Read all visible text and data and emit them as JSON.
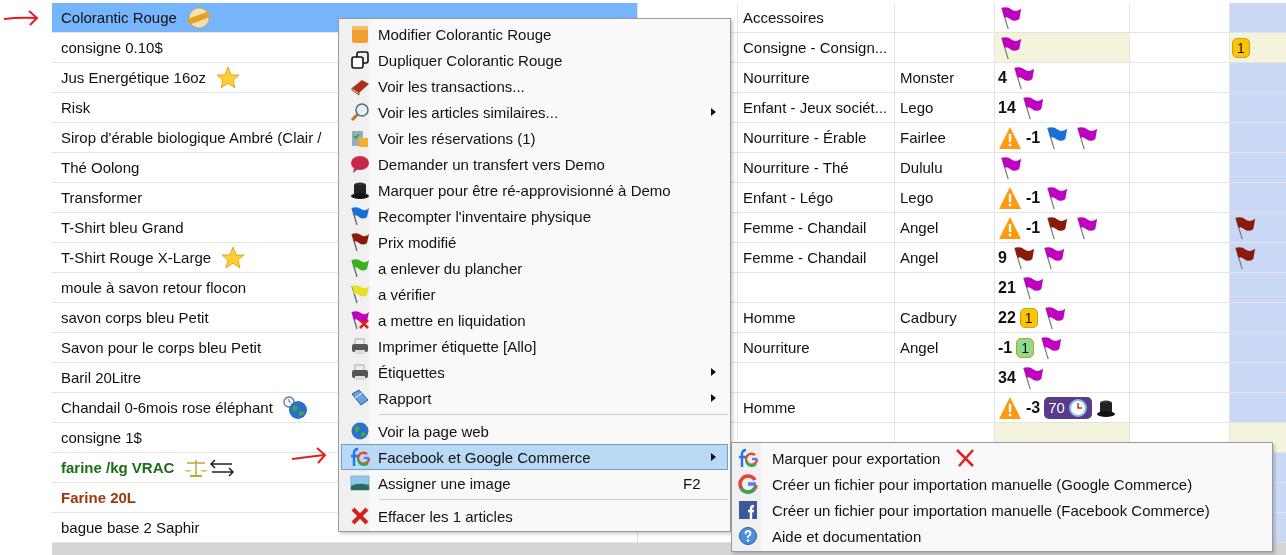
{
  "rows": [
    {
      "name": "Colorantic Rouge",
      "kind": "special",
      "selected": true,
      "qty": "",
      "category": "Accessoires",
      "brand": "",
      "highlight": false,
      "status": [
        {
          "kind": "flag",
          "color": "#c000c0"
        }
      ],
      "extra": []
    },
    {
      "name": "consigne 0.10$",
      "selected": false,
      "category": "Consigne - Consign...",
      "brand": "",
      "highlight": true,
      "status": [
        {
          "kind": "flag",
          "color": "#c000c0"
        }
      ],
      "extra": [
        {
          "kind": "badge",
          "text": "1",
          "color": "#ffc400"
        }
      ]
    },
    {
      "name": "Jus Energétique 16oz",
      "kind": "starred",
      "selected": false,
      "category": "Nourriture",
      "brand": "Monster",
      "highlight": false,
      "status": [
        {
          "kind": "number",
          "text": "4"
        },
        {
          "kind": "flag",
          "color": "#c000c0"
        }
      ],
      "extra": []
    },
    {
      "name": "Risk",
      "selected": false,
      "category": "Enfant - Jeux sociét...",
      "brand": "Lego",
      "highlight": false,
      "status": [
        {
          "kind": "number",
          "text": "14"
        },
        {
          "kind": "flag",
          "color": "#c000c0"
        }
      ],
      "extra": []
    },
    {
      "name": "Sirop d'érable biologique Ambré (Clair /",
      "selected": false,
      "category": "Nourriture - Érable",
      "brand": "Fairlee",
      "highlight": false,
      "status": [
        {
          "kind": "warning"
        },
        {
          "kind": "number",
          "text": "-1"
        },
        {
          "kind": "flag",
          "color": "#1a6fd6"
        },
        {
          "kind": "flag",
          "color": "#c000c0"
        }
      ],
      "extra": []
    },
    {
      "name": "Thé Oolong",
      "selected": false,
      "category": "Nourriture - Thé",
      "brand": "Dululu",
      "highlight": false,
      "status": [
        {
          "kind": "flag",
          "color": "#c000c0"
        }
      ],
      "extra": []
    },
    {
      "name": "Transformer",
      "selected": false,
      "category": "Enfant - Légo",
      "brand": "Lego",
      "highlight": false,
      "status": [
        {
          "kind": "warning"
        },
        {
          "kind": "number",
          "text": "-1"
        },
        {
          "kind": "flag",
          "color": "#c000c0"
        }
      ],
      "extra": []
    },
    {
      "name": "T-Shirt bleu Grand",
      "selected": false,
      "category": "Femme - Chandail",
      "brand": "Angel",
      "highlight": false,
      "status": [
        {
          "kind": "warning"
        },
        {
          "kind": "number",
          "text": "-1"
        },
        {
          "kind": "flag",
          "color": "#8b1a0a"
        },
        {
          "kind": "flag",
          "color": "#c000c0"
        }
      ],
      "extra": [
        {
          "kind": "flag",
          "color": "#8b1a0a"
        }
      ]
    },
    {
      "name": "T-Shirt Rouge X-Large",
      "kind": "starred",
      "selected": false,
      "category": "Femme - Chandail",
      "brand": "Angel",
      "highlight": false,
      "status": [
        {
          "kind": "number",
          "text": "9"
        },
        {
          "kind": "flag",
          "color": "#8b1a0a"
        },
        {
          "kind": "flag",
          "color": "#c000c0"
        }
      ],
      "extra": [
        {
          "kind": "flag",
          "color": "#8b1a0a"
        }
      ]
    },
    {
      "name": "moule à savon retour flocon",
      "selected": false,
      "category": "",
      "brand": "",
      "highlight": false,
      "status": [
        {
          "kind": "number",
          "text": "21"
        },
        {
          "kind": "flag",
          "color": "#c000c0"
        }
      ],
      "extra": []
    },
    {
      "name": "savon corps bleu Petit",
      "selected": false,
      "category": "Homme",
      "brand": "Cadbury",
      "highlight": false,
      "status": [
        {
          "kind": "number",
          "text": "22"
        },
        {
          "kind": "badge",
          "text": "1",
          "color": "#ffc400"
        },
        {
          "kind": "flag",
          "color": "#c000c0"
        }
      ],
      "extra": []
    },
    {
      "name": "Savon pour le corps bleu Petit",
      "selected": false,
      "category": "Nourriture",
      "brand": "Angel",
      "highlight": false,
      "status": [
        {
          "kind": "number",
          "text": "-1"
        },
        {
          "kind": "badge",
          "text": "1",
          "color": "#8fdc8f"
        },
        {
          "kind": "flag",
          "color": "#c000c0"
        }
      ],
      "extra": []
    },
    {
      "name": "Baril 20Litre",
      "selected": false,
      "category": "",
      "brand": "",
      "highlight": false,
      "status": [
        {
          "kind": "number",
          "text": "34"
        },
        {
          "kind": "flag",
          "color": "#c000c0"
        }
      ],
      "extra": []
    },
    {
      "name": "Chandail 0-6mois rose éléphant",
      "kind": "web",
      "selected": false,
      "category": "Homme",
      "brand": "",
      "highlight": false,
      "status": [
        {
          "kind": "warning"
        },
        {
          "kind": "number",
          "text": "-3"
        },
        {
          "kind": "timer",
          "text": "70"
        },
        {
          "kind": "hat"
        }
      ],
      "extra": []
    },
    {
      "name": "consigne 1$",
      "selected": false,
      "category": "",
      "brand": "",
      "highlight": true,
      "status": [],
      "extra": []
    },
    {
      "name": "farine /kg VRAC",
      "kind": "bulk",
      "selected": false,
      "bold": true,
      "color": "#1a6e14",
      "category": "",
      "brand": "",
      "status": [],
      "extra": []
    },
    {
      "name": "Farine 20L",
      "selected": false,
      "bold": true,
      "color": "#9a3a0a",
      "category": "",
      "brand": "",
      "status": [],
      "extra": []
    },
    {
      "name": "bague base 2 Saphir",
      "selected": false,
      "category": "",
      "brand": "",
      "status": [],
      "extra": []
    }
  ],
  "context_menu": [
    {
      "kind": "item",
      "label": "Modifier Colorantic Rouge",
      "submenu": false,
      "selected": false
    },
    {
      "kind": "item",
      "label": "Dupliquer Colorantic Rouge",
      "submenu": false,
      "selected": false
    },
    {
      "kind": "item",
      "label": "Voir les transactions...",
      "submenu": false,
      "selected": false
    },
    {
      "kind": "item",
      "label": "Voir les articles similaires...",
      "submenu": true,
      "selected": false
    },
    {
      "kind": "item",
      "label": "Voir les réservations (1)",
      "submenu": false,
      "selected": false
    },
    {
      "kind": "item",
      "label": "Demander un transfert vers Demo",
      "submenu": false,
      "selected": false
    },
    {
      "kind": "item",
      "label": "Marquer pour être ré-approvisionné à Demo",
      "submenu": false,
      "selected": false
    },
    {
      "kind": "item",
      "label": "Recompter l'inventaire physique",
      "submenu": false,
      "selected": false
    },
    {
      "kind": "item",
      "label": "Prix modifié",
      "submenu": false,
      "selected": false
    },
    {
      "kind": "item",
      "label": "a enlever du plancher",
      "submenu": false,
      "selected": false
    },
    {
      "kind": "item",
      "label": "a vérifier",
      "submenu": false,
      "selected": false
    },
    {
      "kind": "item",
      "label": "a mettre en liquidation",
      "submenu": false,
      "selected": false
    },
    {
      "kind": "item",
      "label": "Imprimer étiquette [Allo]",
      "submenu": false,
      "selected": false
    },
    {
      "kind": "item",
      "label": "Étiquettes",
      "submenu": true,
      "selected": false
    },
    {
      "kind": "item",
      "label": "Rapport",
      "submenu": true,
      "selected": false
    },
    {
      "kind": "separator"
    },
    {
      "kind": "item",
      "label": "Voir la page web",
      "submenu": false,
      "selected": false
    },
    {
      "kind": "item",
      "label": "Facebook et Google Commerce",
      "submenu": true,
      "selected": true
    },
    {
      "kind": "item",
      "label": "Assigner une image",
      "shortcut": "F2",
      "submenu": false,
      "selected": false
    },
    {
      "kind": "separator"
    },
    {
      "kind": "item",
      "label": "Effacer les 1 articles",
      "submenu": false,
      "selected": false
    }
  ],
  "submenu": [
    {
      "label": "Marquer pour exportation",
      "marked": false
    },
    {
      "label": "Créer un fichier pour importation manuelle (Google Commerce)"
    },
    {
      "label": "Créer un fichier pour importation manuelle (Facebook Commerce)"
    },
    {
      "label": "Aide et documentation"
    }
  ]
}
